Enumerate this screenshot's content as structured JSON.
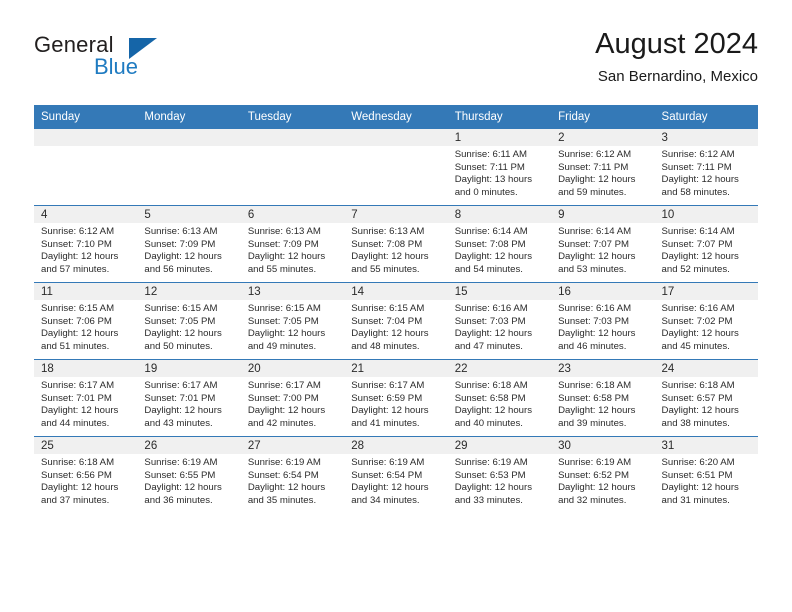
{
  "logo": {
    "word_top": "General",
    "word_bottom": "Blue",
    "triangle_color": "#1565a8",
    "blue_text_color": "#1f7bc1"
  },
  "header": {
    "title": "August 2024",
    "subtitle": "San Bernardino, Mexico"
  },
  "theme": {
    "header_bg": "#3479b7",
    "daynum_band_bg": "#f0f0f0",
    "row_divider": "#3479b7",
    "text": "#2b2b2b"
  },
  "weekdays": [
    "Sunday",
    "Monday",
    "Tuesday",
    "Wednesday",
    "Thursday",
    "Friday",
    "Saturday"
  ],
  "weeks": [
    [
      {
        "day": "",
        "empty": true
      },
      {
        "day": "",
        "empty": true
      },
      {
        "day": "",
        "empty": true
      },
      {
        "day": "",
        "empty": true
      },
      {
        "day": "1",
        "sunrise": "Sunrise: 6:11 AM",
        "sunset": "Sunset: 7:11 PM",
        "daylight1": "Daylight: 13 hours",
        "daylight2": "and 0 minutes."
      },
      {
        "day": "2",
        "sunrise": "Sunrise: 6:12 AM",
        "sunset": "Sunset: 7:11 PM",
        "daylight1": "Daylight: 12 hours",
        "daylight2": "and 59 minutes."
      },
      {
        "day": "3",
        "sunrise": "Sunrise: 6:12 AM",
        "sunset": "Sunset: 7:11 PM",
        "daylight1": "Daylight: 12 hours",
        "daylight2": "and 58 minutes."
      }
    ],
    [
      {
        "day": "4",
        "sunrise": "Sunrise: 6:12 AM",
        "sunset": "Sunset: 7:10 PM",
        "daylight1": "Daylight: 12 hours",
        "daylight2": "and 57 minutes."
      },
      {
        "day": "5",
        "sunrise": "Sunrise: 6:13 AM",
        "sunset": "Sunset: 7:09 PM",
        "daylight1": "Daylight: 12 hours",
        "daylight2": "and 56 minutes."
      },
      {
        "day": "6",
        "sunrise": "Sunrise: 6:13 AM",
        "sunset": "Sunset: 7:09 PM",
        "daylight1": "Daylight: 12 hours",
        "daylight2": "and 55 minutes."
      },
      {
        "day": "7",
        "sunrise": "Sunrise: 6:13 AM",
        "sunset": "Sunset: 7:08 PM",
        "daylight1": "Daylight: 12 hours",
        "daylight2": "and 55 minutes."
      },
      {
        "day": "8",
        "sunrise": "Sunrise: 6:14 AM",
        "sunset": "Sunset: 7:08 PM",
        "daylight1": "Daylight: 12 hours",
        "daylight2": "and 54 minutes."
      },
      {
        "day": "9",
        "sunrise": "Sunrise: 6:14 AM",
        "sunset": "Sunset: 7:07 PM",
        "daylight1": "Daylight: 12 hours",
        "daylight2": "and 53 minutes."
      },
      {
        "day": "10",
        "sunrise": "Sunrise: 6:14 AM",
        "sunset": "Sunset: 7:07 PM",
        "daylight1": "Daylight: 12 hours",
        "daylight2": "and 52 minutes."
      }
    ],
    [
      {
        "day": "11",
        "sunrise": "Sunrise: 6:15 AM",
        "sunset": "Sunset: 7:06 PM",
        "daylight1": "Daylight: 12 hours",
        "daylight2": "and 51 minutes."
      },
      {
        "day": "12",
        "sunrise": "Sunrise: 6:15 AM",
        "sunset": "Sunset: 7:05 PM",
        "daylight1": "Daylight: 12 hours",
        "daylight2": "and 50 minutes."
      },
      {
        "day": "13",
        "sunrise": "Sunrise: 6:15 AM",
        "sunset": "Sunset: 7:05 PM",
        "daylight1": "Daylight: 12 hours",
        "daylight2": "and 49 minutes."
      },
      {
        "day": "14",
        "sunrise": "Sunrise: 6:15 AM",
        "sunset": "Sunset: 7:04 PM",
        "daylight1": "Daylight: 12 hours",
        "daylight2": "and 48 minutes."
      },
      {
        "day": "15",
        "sunrise": "Sunrise: 6:16 AM",
        "sunset": "Sunset: 7:03 PM",
        "daylight1": "Daylight: 12 hours",
        "daylight2": "and 47 minutes."
      },
      {
        "day": "16",
        "sunrise": "Sunrise: 6:16 AM",
        "sunset": "Sunset: 7:03 PM",
        "daylight1": "Daylight: 12 hours",
        "daylight2": "and 46 minutes."
      },
      {
        "day": "17",
        "sunrise": "Sunrise: 6:16 AM",
        "sunset": "Sunset: 7:02 PM",
        "daylight1": "Daylight: 12 hours",
        "daylight2": "and 45 minutes."
      }
    ],
    [
      {
        "day": "18",
        "sunrise": "Sunrise: 6:17 AM",
        "sunset": "Sunset: 7:01 PM",
        "daylight1": "Daylight: 12 hours",
        "daylight2": "and 44 minutes."
      },
      {
        "day": "19",
        "sunrise": "Sunrise: 6:17 AM",
        "sunset": "Sunset: 7:01 PM",
        "daylight1": "Daylight: 12 hours",
        "daylight2": "and 43 minutes."
      },
      {
        "day": "20",
        "sunrise": "Sunrise: 6:17 AM",
        "sunset": "Sunset: 7:00 PM",
        "daylight1": "Daylight: 12 hours",
        "daylight2": "and 42 minutes."
      },
      {
        "day": "21",
        "sunrise": "Sunrise: 6:17 AM",
        "sunset": "Sunset: 6:59 PM",
        "daylight1": "Daylight: 12 hours",
        "daylight2": "and 41 minutes."
      },
      {
        "day": "22",
        "sunrise": "Sunrise: 6:18 AM",
        "sunset": "Sunset: 6:58 PM",
        "daylight1": "Daylight: 12 hours",
        "daylight2": "and 40 minutes."
      },
      {
        "day": "23",
        "sunrise": "Sunrise: 6:18 AM",
        "sunset": "Sunset: 6:58 PM",
        "daylight1": "Daylight: 12 hours",
        "daylight2": "and 39 minutes."
      },
      {
        "day": "24",
        "sunrise": "Sunrise: 6:18 AM",
        "sunset": "Sunset: 6:57 PM",
        "daylight1": "Daylight: 12 hours",
        "daylight2": "and 38 minutes."
      }
    ],
    [
      {
        "day": "25",
        "sunrise": "Sunrise: 6:18 AM",
        "sunset": "Sunset: 6:56 PM",
        "daylight1": "Daylight: 12 hours",
        "daylight2": "and 37 minutes."
      },
      {
        "day": "26",
        "sunrise": "Sunrise: 6:19 AM",
        "sunset": "Sunset: 6:55 PM",
        "daylight1": "Daylight: 12 hours",
        "daylight2": "and 36 minutes."
      },
      {
        "day": "27",
        "sunrise": "Sunrise: 6:19 AM",
        "sunset": "Sunset: 6:54 PM",
        "daylight1": "Daylight: 12 hours",
        "daylight2": "and 35 minutes."
      },
      {
        "day": "28",
        "sunrise": "Sunrise: 6:19 AM",
        "sunset": "Sunset: 6:54 PM",
        "daylight1": "Daylight: 12 hours",
        "daylight2": "and 34 minutes."
      },
      {
        "day": "29",
        "sunrise": "Sunrise: 6:19 AM",
        "sunset": "Sunset: 6:53 PM",
        "daylight1": "Daylight: 12 hours",
        "daylight2": "and 33 minutes."
      },
      {
        "day": "30",
        "sunrise": "Sunrise: 6:19 AM",
        "sunset": "Sunset: 6:52 PM",
        "daylight1": "Daylight: 12 hours",
        "daylight2": "and 32 minutes."
      },
      {
        "day": "31",
        "sunrise": "Sunrise: 6:20 AM",
        "sunset": "Sunset: 6:51 PM",
        "daylight1": "Daylight: 12 hours",
        "daylight2": "and 31 minutes."
      }
    ]
  ]
}
